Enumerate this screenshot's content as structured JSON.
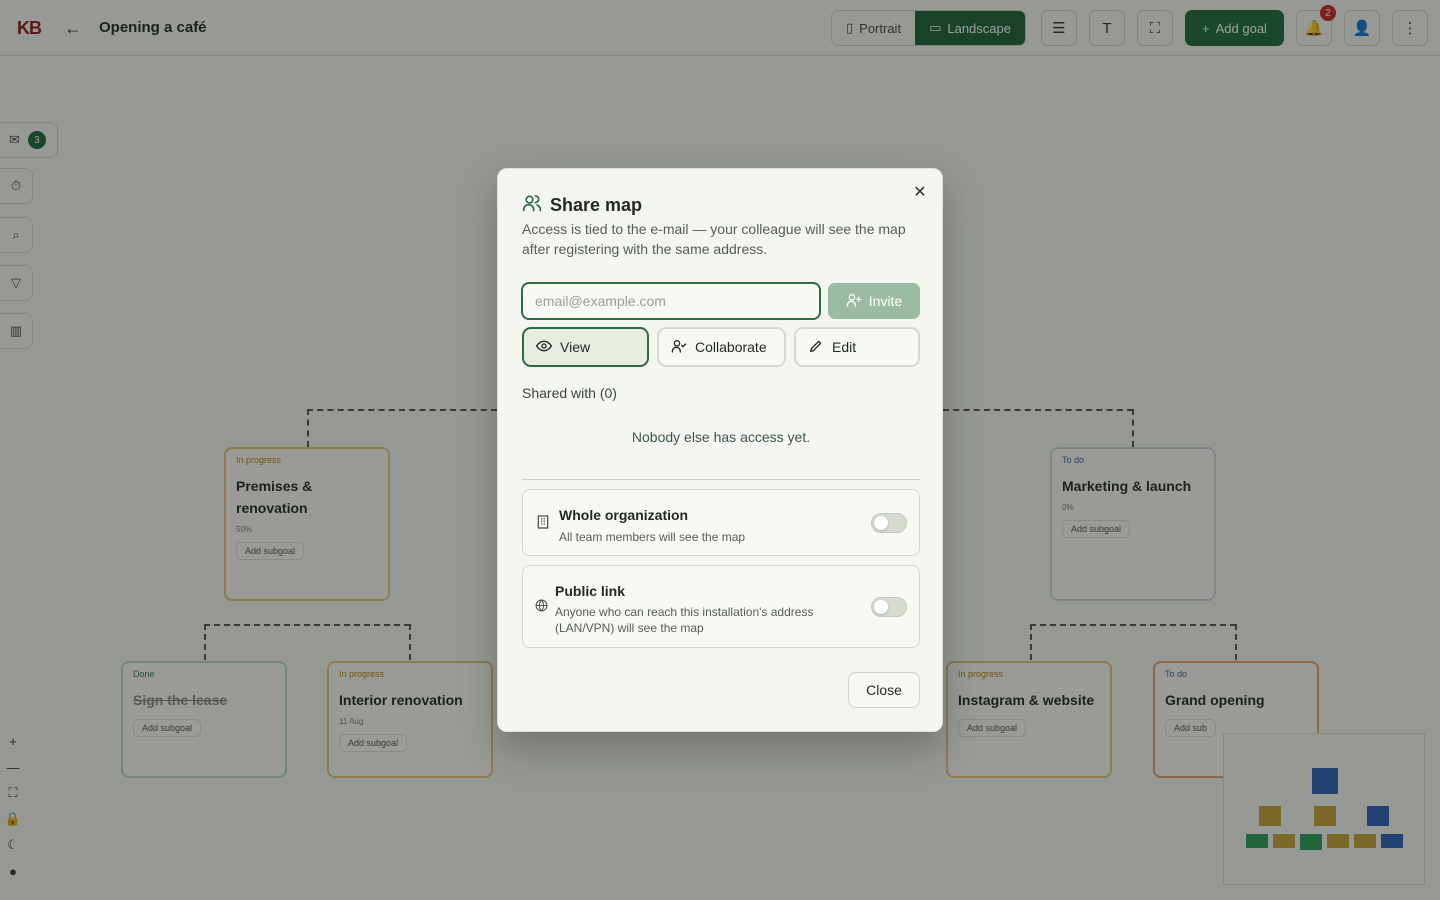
{
  "topbar": {
    "logo": "KB",
    "back_icon": "arrow-left-icon",
    "title": "Opening a café",
    "orientation": {
      "portrait": "Portrait",
      "landscape": "Landscape"
    },
    "add_goal": "Add goal",
    "notifications_count": "2"
  },
  "rail": {
    "inbox_count": "3"
  },
  "canvas": {
    "cards": [
      {
        "status": "In progress",
        "title": "Premises & renovation",
        "progress": "50%",
        "add": "Add subgoal"
      },
      {
        "status": "To do",
        "title": "Marketing & launch",
        "progress": "0%",
        "add": "Add subgoal"
      },
      {
        "status": "Done",
        "title": "Sign the lease",
        "add": "Add subgoal"
      },
      {
        "status": "In progress",
        "title": "Interior renovation",
        "date": "11 Aug",
        "add": "Add subgoal"
      },
      {
        "status": "In progress",
        "title": "Instagram & website",
        "add": "Add subgoal"
      },
      {
        "status": "To do",
        "title": "Grand opening",
        "add": "Add sub"
      }
    ],
    "colors": {
      "in_progress": "#e2c37a",
      "done": "#b7d8bf",
      "todo": "#cfd7e0",
      "accent": "#1f6b3f"
    }
  },
  "modal": {
    "title": "Share map",
    "description": "Access is tied to the e-mail — your colleague will see the map after registering with the same address.",
    "email_placeholder": "email@example.com",
    "invite": "Invite",
    "permissions": {
      "view": "View",
      "collaborate": "Collaborate",
      "edit": "Edit",
      "selected": "View"
    },
    "shared_with": "Shared with (0)",
    "empty": "Nobody else has access yet.",
    "org": {
      "title": "Whole organization",
      "subtitle": "All team members will see the map",
      "enabled": false
    },
    "public": {
      "title": "Public link",
      "subtitle": "Anyone who can reach this installation's address (LAN/VPN) will see the map",
      "enabled": false
    },
    "close": "Close"
  }
}
